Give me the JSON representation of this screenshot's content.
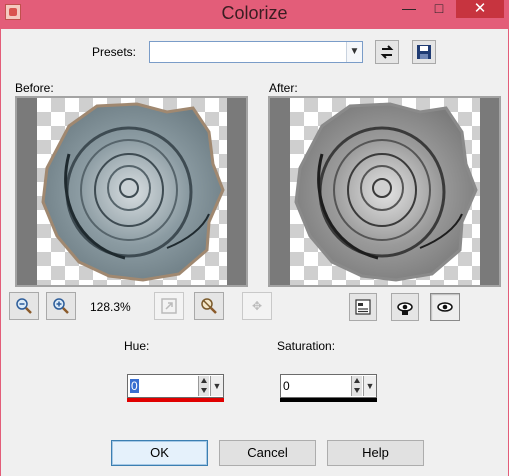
{
  "window": {
    "title": "Colorize",
    "minimize_glyph": "—",
    "maximize_glyph": "□",
    "close_glyph": "✕"
  },
  "presets": {
    "label": "Presets:",
    "value": "",
    "reset_icon": "reset-defaults-icon",
    "save_icon": "save-preset-icon"
  },
  "preview": {
    "before_label": "Before:",
    "after_label": "After:",
    "zoom_level": "128.3%"
  },
  "toolbar_icons": [
    "zoom-out-icon",
    "zoom-in-icon",
    "zoom-to-fit-icon",
    "proof-icon",
    "pan-icon",
    "navigate-icon",
    "auto-proof-icon",
    "preview-on-image-icon"
  ],
  "hue": {
    "label": "Hue:",
    "value": "0",
    "bar_color": "#e00000"
  },
  "saturation": {
    "label": "Saturation:",
    "value": "0",
    "bar_color": "#000000"
  },
  "buttons": {
    "ok": "OK",
    "cancel": "Cancel",
    "help": "Help"
  },
  "colors": {
    "title_bar": "#e35d79",
    "close_button": "#c7343f",
    "dialog_bg": "#f0f0f0",
    "before_rose_tint": "#8fa0a6",
    "after_rose_tint": "#9a9a9a"
  }
}
